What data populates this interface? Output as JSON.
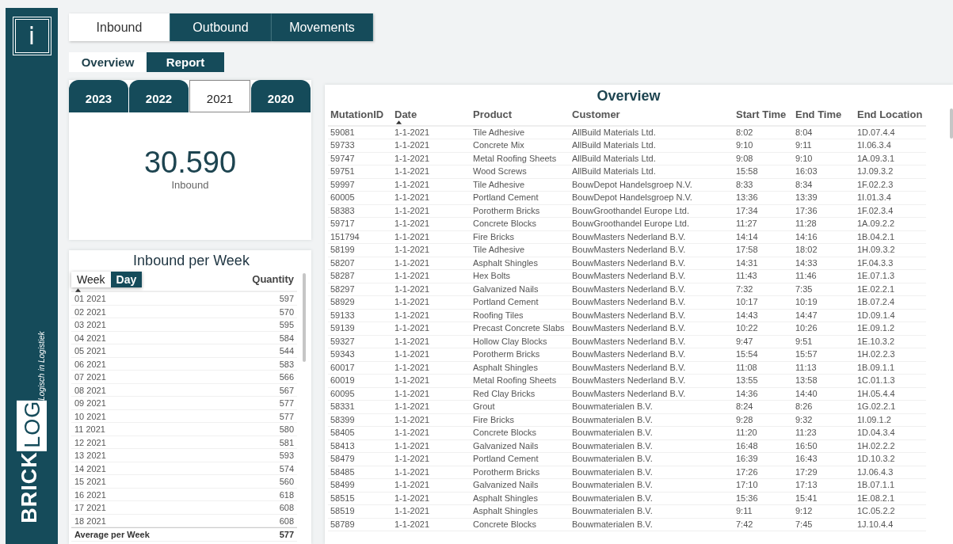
{
  "sidebar": {
    "info_button": "i",
    "logo": {
      "word_1": "BRICK",
      "word_2": "LOG",
      "tagline": "Logisch in Logistiek"
    }
  },
  "nav_tabs": [
    {
      "label": "Inbound",
      "selected": true
    },
    {
      "label": "Outbound",
      "selected": false
    },
    {
      "label": "Movements",
      "selected": false
    }
  ],
  "view_tabs": [
    {
      "label": "Overview",
      "selected": true
    },
    {
      "label": "Report",
      "selected": false
    }
  ],
  "year_tabs": [
    {
      "label": "2023",
      "selected": false
    },
    {
      "label": "2022",
      "selected": false
    },
    {
      "label": "2021",
      "selected": true
    },
    {
      "label": "2020",
      "selected": false
    }
  ],
  "kpi": {
    "value": "30.590",
    "label": "Inbound"
  },
  "weekly_table": {
    "title": "Inbound per Week",
    "toggle": [
      {
        "label": "Week",
        "selected": true,
        "sorted": true
      },
      {
        "label": "Day",
        "selected": false,
        "sorted": false
      }
    ],
    "quantity_header": "Quantity",
    "rows": [
      {
        "week": "01 2021",
        "quantity": "597"
      },
      {
        "week": "02 2021",
        "quantity": "570"
      },
      {
        "week": "03 2021",
        "quantity": "595"
      },
      {
        "week": "04 2021",
        "quantity": "584"
      },
      {
        "week": "05 2021",
        "quantity": "544"
      },
      {
        "week": "06 2021",
        "quantity": "583"
      },
      {
        "week": "07 2021",
        "quantity": "566"
      },
      {
        "week": "08 2021",
        "quantity": "567"
      },
      {
        "week": "09 2021",
        "quantity": "577"
      },
      {
        "week": "10 2021",
        "quantity": "577"
      },
      {
        "week": "11 2021",
        "quantity": "580"
      },
      {
        "week": "12 2021",
        "quantity": "581"
      },
      {
        "week": "13 2021",
        "quantity": "593"
      },
      {
        "week": "14 2021",
        "quantity": "574"
      },
      {
        "week": "15 2021",
        "quantity": "560"
      },
      {
        "week": "16 2021",
        "quantity": "618"
      },
      {
        "week": "17 2021",
        "quantity": "608"
      },
      {
        "week": "18 2021",
        "quantity": "608"
      }
    ],
    "total": {
      "label": "Average per Week",
      "value": "577"
    }
  },
  "overview_table": {
    "title": "Overview",
    "columns": [
      {
        "label": "MutationID",
        "sorted": false
      },
      {
        "label": "Date",
        "sorted": true
      },
      {
        "label": "Product",
        "sorted": false
      },
      {
        "label": "Customer",
        "sorted": false
      },
      {
        "label": "Start Time",
        "sorted": false
      },
      {
        "label": "End Time",
        "sorted": false
      },
      {
        "label": "End Location",
        "sorted": false
      }
    ],
    "rows": [
      [
        "59081",
        "1-1-2021",
        "Tile Adhesive",
        "AllBuild Materials Ltd.",
        "8:02",
        "8:04",
        "1D.07.4.4"
      ],
      [
        "59733",
        "1-1-2021",
        "Concrete Mix",
        "AllBuild Materials Ltd.",
        "9:10",
        "9:11",
        "1I.06.3.4"
      ],
      [
        "59747",
        "1-1-2021",
        "Metal Roofing Sheets",
        "AllBuild Materials Ltd.",
        "9:08",
        "9:10",
        "1A.09.3.1"
      ],
      [
        "59751",
        "1-1-2021",
        "Wood Screws",
        "AllBuild Materials Ltd.",
        "15:58",
        "16:03",
        "1J.09.3.2"
      ],
      [
        "59997",
        "1-1-2021",
        "Tile Adhesive",
        "BouwDepot Handelsgroep N.V.",
        "8:33",
        "8:34",
        "1F.02.2.3"
      ],
      [
        "60005",
        "1-1-2021",
        "Portland Cement",
        "BouwDepot Handelsgroep N.V.",
        "13:36",
        "13:39",
        "1I.01.3.4"
      ],
      [
        "58383",
        "1-1-2021",
        "Porotherm Bricks",
        "BouwGroothandel Europe Ltd.",
        "17:34",
        "17:36",
        "1F.02.3.4"
      ],
      [
        "59717",
        "1-1-2021",
        "Concrete Blocks",
        "BouwGroothandel Europe Ltd.",
        "11:27",
        "11:28",
        "1A.09.2.2"
      ],
      [
        "151794",
        "1-1-2021",
        "Fire Bricks",
        "BouwMasters Nederland B.V.",
        "14:14",
        "14:16",
        "1B.04.2.1"
      ],
      [
        "58199",
        "1-1-2021",
        "Tile Adhesive",
        "BouwMasters Nederland B.V.",
        "17:58",
        "18:02",
        "1H.09.3.2"
      ],
      [
        "58207",
        "1-1-2021",
        "Asphalt Shingles",
        "BouwMasters Nederland B.V.",
        "14:31",
        "14:33",
        "1F.04.3.3"
      ],
      [
        "58287",
        "1-1-2021",
        "Hex Bolts",
        "BouwMasters Nederland B.V.",
        "11:43",
        "11:46",
        "1E.07.1.3"
      ],
      [
        "58297",
        "1-1-2021",
        "Galvanized Nails",
        "BouwMasters Nederland B.V.",
        "7:32",
        "7:35",
        "1E.02.2.1"
      ],
      [
        "58929",
        "1-1-2021",
        "Portland Cement",
        "BouwMasters Nederland B.V.",
        "10:17",
        "10:19",
        "1B.07.2.4"
      ],
      [
        "59133",
        "1-1-2021",
        "Roofing Tiles",
        "BouwMasters Nederland B.V.",
        "14:43",
        "14:47",
        "1D.09.1.4"
      ],
      [
        "59139",
        "1-1-2021",
        "Precast Concrete Slabs",
        "BouwMasters Nederland B.V.",
        "10:22",
        "10:26",
        "1E.09.1.2"
      ],
      [
        "59327",
        "1-1-2021",
        "Hollow Clay Blocks",
        "BouwMasters Nederland B.V.",
        "9:47",
        "9:51",
        "1E.10.3.2"
      ],
      [
        "59343",
        "1-1-2021",
        "Porotherm Bricks",
        "BouwMasters Nederland B.V.",
        "15:54",
        "15:57",
        "1H.02.2.3"
      ],
      [
        "60017",
        "1-1-2021",
        "Asphalt Shingles",
        "BouwMasters Nederland B.V.",
        "11:08",
        "11:13",
        "1B.09.1.1"
      ],
      [
        "60019",
        "1-1-2021",
        "Metal Roofing Sheets",
        "BouwMasters Nederland B.V.",
        "13:55",
        "13:58",
        "1C.01.1.3"
      ],
      [
        "60095",
        "1-1-2021",
        "Red Clay Bricks",
        "BouwMasters Nederland B.V.",
        "14:36",
        "14:40",
        "1H.05.4.4"
      ],
      [
        "58331",
        "1-1-2021",
        "Grout",
        "Bouwmaterialen B.V.",
        "8:24",
        "8:26",
        "1G.02.2.1"
      ],
      [
        "58399",
        "1-1-2021",
        "Fire Bricks",
        "Bouwmaterialen B.V.",
        "9:28",
        "9:32",
        "1I.09.1.2"
      ],
      [
        "58405",
        "1-1-2021",
        "Concrete Blocks",
        "Bouwmaterialen B.V.",
        "11:20",
        "11:23",
        "1D.04.3.4"
      ],
      [
        "58413",
        "1-1-2021",
        "Galvanized Nails",
        "Bouwmaterialen B.V.",
        "16:48",
        "16:50",
        "1H.02.2.2"
      ],
      [
        "58479",
        "1-1-2021",
        "Portland Cement",
        "Bouwmaterialen B.V.",
        "16:39",
        "16:43",
        "1D.10.3.2"
      ],
      [
        "58485",
        "1-1-2021",
        "Porotherm Bricks",
        "Bouwmaterialen B.V.",
        "17:26",
        "17:29",
        "1J.06.4.3"
      ],
      [
        "58499",
        "1-1-2021",
        "Galvanized Nails",
        "Bouwmaterialen B.V.",
        "17:10",
        "17:13",
        "1B.07.1.1"
      ],
      [
        "58515",
        "1-1-2021",
        "Asphalt Shingles",
        "Bouwmaterialen B.V.",
        "15:36",
        "15:41",
        "1E.08.2.1"
      ],
      [
        "58519",
        "1-1-2021",
        "Asphalt Shingles",
        "Bouwmaterialen B.V.",
        "9:11",
        "9:12",
        "1C.05.2.2"
      ],
      [
        "58789",
        "1-1-2021",
        "Concrete Blocks",
        "Bouwmaterialen B.V.",
        "7:42",
        "7:45",
        "1J.10.4.4"
      ]
    ]
  }
}
